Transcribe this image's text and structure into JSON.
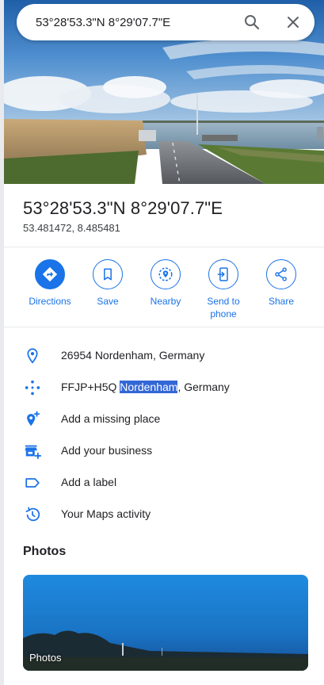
{
  "search": {
    "value": "53°28'53.3\"N 8°29'07.7\"E",
    "search_icon": "search-icon",
    "close_icon": "close-icon"
  },
  "place": {
    "title": "53°28'53.3\"N 8°29'07.7\"E",
    "coordinates": "53.481472, 8.485481"
  },
  "actions": [
    {
      "label": "Directions",
      "icon": "directions-icon"
    },
    {
      "label": "Save",
      "icon": "bookmark-icon"
    },
    {
      "label": "Nearby",
      "icon": "nearby-icon"
    },
    {
      "label": "Send to phone",
      "icon": "send-to-phone-icon"
    },
    {
      "label": "Share",
      "icon": "share-icon"
    }
  ],
  "info": {
    "address": "26954 Nordenham, Germany",
    "plus_code_prefix": "FFJP+H5Q ",
    "plus_code_highlight": "Nordenham",
    "plus_code_suffix": ", Germany",
    "add_missing_place": "Add a missing place",
    "add_business": "Add your business",
    "add_label": "Add a label",
    "maps_activity": "Your Maps activity"
  },
  "photos": {
    "heading": "Photos",
    "card_label": "Photos"
  },
  "colors": {
    "accent": "#1a73e8",
    "text": "#202124",
    "selection": "#3367d6"
  }
}
